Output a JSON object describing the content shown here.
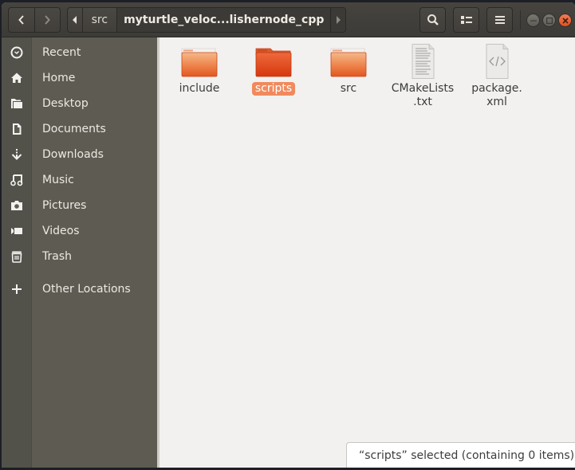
{
  "window": {
    "title": "myturtle_veloc...lishernode_cpp",
    "accent_color": "#e95420"
  },
  "header": {
    "back_icon": "chevron-left-icon",
    "forward_icon": "chevron-right-icon",
    "breadcrumbs": [
      {
        "label": "src"
      },
      {
        "label": "myturtle_veloc...lishernode_cpp"
      }
    ],
    "search_icon": "search-icon",
    "view_icon": "list-view-icon",
    "menu_icon": "hamburger-menu-icon",
    "window_controls": {
      "minimize": "–",
      "maximize": "□",
      "close": "×"
    }
  },
  "sidebar": {
    "items": [
      {
        "label": "Recent",
        "icon": "clock-icon"
      },
      {
        "label": "Home",
        "icon": "home-icon"
      },
      {
        "label": "Desktop",
        "icon": "folder-icon"
      },
      {
        "label": "Documents",
        "icon": "document-icon"
      },
      {
        "label": "Downloads",
        "icon": "download-icon"
      },
      {
        "label": "Music",
        "icon": "music-icon"
      },
      {
        "label": "Pictures",
        "icon": "camera-icon"
      },
      {
        "label": "Videos",
        "icon": "video-icon"
      },
      {
        "label": "Trash",
        "icon": "trash-icon"
      },
      {
        "label": "Other Locations",
        "icon": "plus-icon"
      }
    ]
  },
  "files": [
    {
      "name": "include",
      "type": "folder",
      "selected": false
    },
    {
      "name": "scripts",
      "type": "folder",
      "selected": true
    },
    {
      "name": "src",
      "type": "folder",
      "selected": false
    },
    {
      "name": "CMakeLists\n.txt",
      "line1": "CMakeLists",
      "line2": ".txt",
      "type": "text",
      "selected": false
    },
    {
      "name": "package.\nxml",
      "line1": "package.",
      "line2": "xml",
      "type": "xml",
      "selected": false
    }
  ],
  "status": {
    "text": "“scripts” selected  (containing 0 items)"
  }
}
